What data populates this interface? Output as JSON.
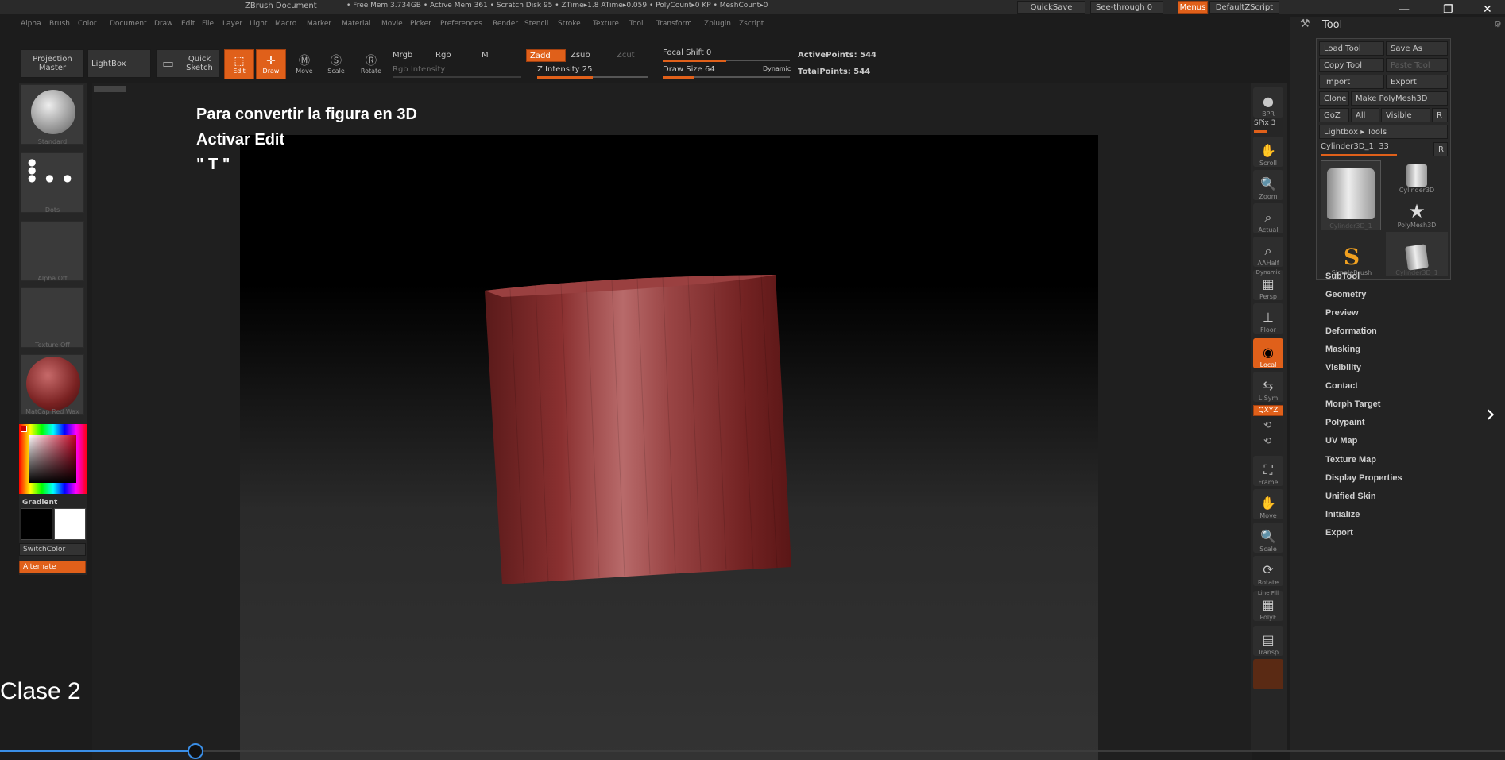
{
  "titlebar": {
    "doc_title": "ZBrush Document",
    "stats": "• Free Mem 3.734GB • Active Mem 361 • Scratch Disk 95 • ZTime▸1.8 ATime▸0.059 • PolyCount▸0 KP • MeshCount▸0",
    "quicksave": "QuickSave",
    "see_through": "See-through  0",
    "menus": "Menus",
    "default_zscript": "DefaultZScript"
  },
  "menubar": [
    "Alpha",
    "Brush",
    "Color",
    "Document",
    "Draw",
    "Edit",
    "File",
    "Layer",
    "Light",
    "Macro",
    "Marker",
    "Material",
    "Movie",
    "Picker",
    "Preferences",
    "Render",
    "Stencil",
    "Stroke",
    "Texture",
    "Tool",
    "Transform",
    "Zplugin",
    "Zscript"
  ],
  "toolbar": {
    "projection_master": "Projection Master",
    "lightbox": "LightBox",
    "quick_sketch": "Quick Sketch",
    "edit": "Edit",
    "draw": "Draw",
    "move": "Move",
    "scale": "Scale",
    "rotate": "Rotate",
    "mrgb": "Mrgb",
    "rgb": "Rgb",
    "m": "M",
    "rgb_intensity": "Rgb Intensity",
    "zadd": "Zadd",
    "zsub": "Zsub",
    "zcut": "Zcut",
    "z_intensity": "Z Intensity 25",
    "focal_shift": "Focal Shift 0",
    "draw_size": "Draw Size 64",
    "dynamic": "Dynamic",
    "active_points": "ActivePoints: 544",
    "total_points": "TotalPoints: 544"
  },
  "leftshelf": {
    "standard": "Standard",
    "dots": "Dots",
    "alpha_off": "Alpha Off",
    "texture_off": "Texture Off",
    "matcap": "MatCap Red Wax",
    "gradient": "Gradient",
    "switchcolor": "SwitchColor",
    "alternate": "Alternate"
  },
  "overlay": {
    "line1": "Para convertir la figura en 3D",
    "line2": "Activar Edit",
    "line3": "\" T \""
  },
  "rightshelf": {
    "bpr": "BPR",
    "spix": "SPix 3",
    "scroll": "Scroll",
    "zoom": "Zoom",
    "actual": "Actual",
    "aahalf": "AAHalf",
    "dynamic": "Dynamic",
    "persp": "Persp",
    "floor": "Floor",
    "local": "Local",
    "lsym": "L.Sym",
    "qxyz": "QXYZ",
    "frame": "Frame",
    "move": "Move",
    "scale": "Scale",
    "rotate": "Rotate",
    "linefill": "Line Fill",
    "polyf": "PolyF",
    "transp": "Transp"
  },
  "toolpanel": {
    "title": "Tool",
    "load_tool": "Load Tool",
    "save_as": "Save As",
    "copy_tool": "Copy Tool",
    "paste_tool": "Paste Tool",
    "import": "Import",
    "export": "Export",
    "clone": "Clone",
    "make_polymesh": "Make PolyMesh3D",
    "goz": "GoZ",
    "all": "All",
    "visible": "Visible",
    "r": "R",
    "lightbox_tools": "Lightbox ▸ Tools",
    "current_tool": "Cylinder3D_1. 33",
    "thumbs": {
      "cylinder_big": "Cylinder3D_1",
      "cylinder": "Cylinder3D",
      "polymesh": "PolyMesh3D",
      "simplebrush": "SimpleBrush",
      "cylinder_small": "Cylinder3D_1"
    },
    "sections": [
      "SubTool",
      "Geometry",
      "Preview",
      "Deformation",
      "Masking",
      "Visibility",
      "Contact",
      "Morph Target",
      "Polypaint",
      "UV Map",
      "Texture Map",
      "Display Properties",
      "Unified Skin",
      "Initialize",
      "Export"
    ]
  },
  "video": {
    "clase": "Clase 2",
    "progress": 0.13
  },
  "colors": {
    "accent": "#e0601a",
    "progress": "#3a8ee6",
    "cylinder": "#8a3535"
  }
}
